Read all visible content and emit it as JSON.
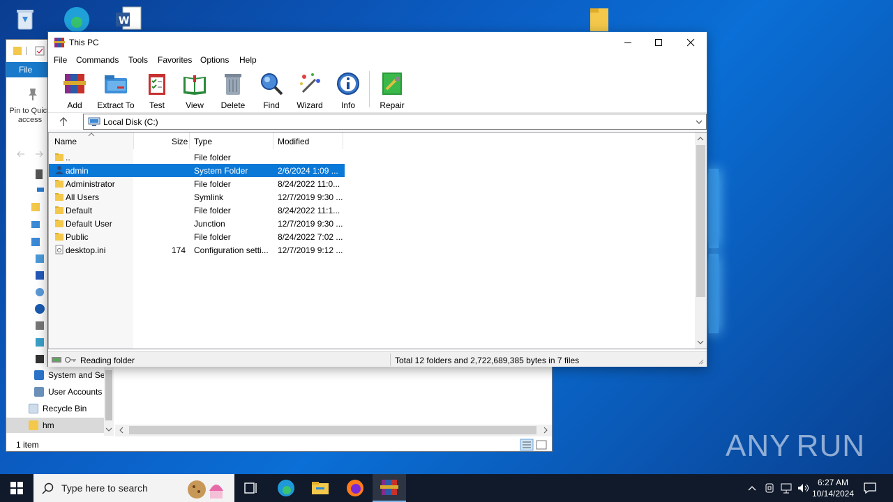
{
  "winrar": {
    "title": "This PC",
    "menu": [
      "File",
      "Commands",
      "Tools",
      "Favorites",
      "Options",
      "Help"
    ],
    "toolbar": [
      {
        "label": "Add",
        "icon": "add-archive-icon"
      },
      {
        "label": "Extract To",
        "icon": "extract-folder-icon"
      },
      {
        "label": "Test",
        "icon": "test-checklist-icon"
      },
      {
        "label": "View",
        "icon": "view-book-icon"
      },
      {
        "label": "Delete",
        "icon": "trash-icon"
      },
      {
        "label": "Find",
        "icon": "magnifier-icon"
      },
      {
        "label": "Wizard",
        "icon": "wand-icon"
      },
      {
        "label": "Info",
        "icon": "info-icon"
      },
      {
        "label": "Repair",
        "icon": "repair-icon"
      }
    ],
    "address": "Local Disk (C:)",
    "columns": {
      "name": "Name",
      "size": "Size",
      "type": "Type",
      "modified": "Modified"
    },
    "files": [
      {
        "name": "..",
        "size": "",
        "type": "File folder",
        "modified": "",
        "icon": "folder-icon"
      },
      {
        "name": "admin",
        "size": "",
        "type": "System Folder",
        "modified": "2/6/2024 1:09 ...",
        "icon": "user-folder-icon"
      },
      {
        "name": "Administrator",
        "size": "",
        "type": "File folder",
        "modified": "8/24/2022 11:0...",
        "icon": "folder-icon"
      },
      {
        "name": "All Users",
        "size": "",
        "type": "Symlink",
        "modified": "12/7/2019 9:30 ...",
        "icon": "folder-icon"
      },
      {
        "name": "Default",
        "size": "",
        "type": "File folder",
        "modified": "8/24/2022 11:1...",
        "icon": "folder-icon"
      },
      {
        "name": "Default User",
        "size": "",
        "type": "Junction",
        "modified": "12/7/2019 9:30 ...",
        "icon": "folder-icon"
      },
      {
        "name": "Public",
        "size": "",
        "type": "File folder",
        "modified": "8/24/2022 7:02 ...",
        "icon": "folder-icon"
      },
      {
        "name": "desktop.ini",
        "size": "174",
        "type": "Configuration setti...",
        "modified": "12/7/2019 9:12 ...",
        "icon": "settings-file-icon"
      }
    ],
    "status_left": "Reading folder",
    "status_right": "Total 12 folders and 2,722,689,385 bytes in 7 files"
  },
  "explorer": {
    "ribbon_file": "File",
    "pin_label": "Pin to Quick access",
    "nav_items": [
      {
        "label": "System and Se",
        "icon": "system-security-icon"
      },
      {
        "label": "User Accounts",
        "icon": "user-accounts-icon"
      },
      {
        "label": "Recycle Bin",
        "icon": "recycle-bin-icon"
      },
      {
        "label": "hm",
        "icon": "folder-icon"
      }
    ],
    "status": "1 item"
  },
  "taskbar": {
    "search_placeholder": "Type here to search",
    "time": "6:27 AM",
    "date": "10/14/2024"
  },
  "watermark": "ANY RUN",
  "colors": {
    "selection": "#0a78d7",
    "taskbar": "#101a2b",
    "accent": "#1979ca"
  }
}
